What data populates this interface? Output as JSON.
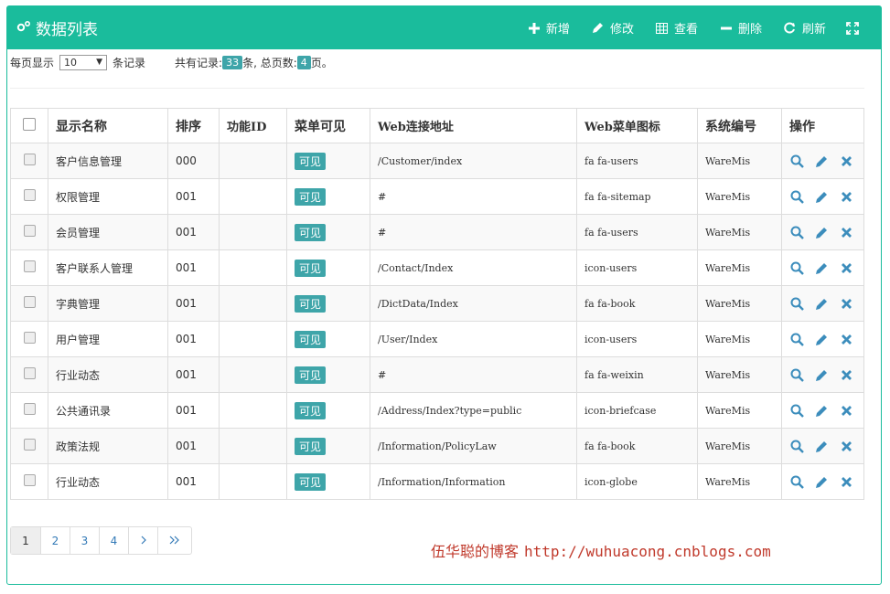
{
  "header": {
    "title": "数据列表",
    "actions": [
      {
        "label": "新增",
        "icon": "plus-icon"
      },
      {
        "label": "修改",
        "icon": "pencil-icon"
      },
      {
        "label": "查看",
        "icon": "table-icon"
      },
      {
        "label": "删除",
        "icon": "minus-icon"
      },
      {
        "label": "刷新",
        "icon": "refresh-icon"
      }
    ],
    "expand_icon": "expand-icon"
  },
  "filter": {
    "per_page_label": "每页显示",
    "per_page_value": "10",
    "records_label": "条记录",
    "total_label": "共有记录:",
    "total_count": "33",
    "total_suffix": "条, 总页数:",
    "pages_count": "4",
    "pages_suffix": "页。"
  },
  "table": {
    "columns": [
      "显示名称",
      "排序",
      "功能ID",
      "菜单可见",
      "Web连接地址",
      "Web菜单图标",
      "系统编号",
      "操作"
    ],
    "rows": [
      {
        "name": "客户信息管理",
        "sort": "000",
        "func_id": "",
        "visible": "可见",
        "url": "/Customer/index",
        "icon": "fa fa-users",
        "sys": "WareMis"
      },
      {
        "name": "权限管理",
        "sort": "001",
        "func_id": "",
        "visible": "可见",
        "url": "#",
        "icon": "fa fa-sitemap",
        "sys": "WareMis"
      },
      {
        "name": "会员管理",
        "sort": "001",
        "func_id": "",
        "visible": "可见",
        "url": "#",
        "icon": "fa fa-users",
        "sys": "WareMis"
      },
      {
        "name": "客户联系人管理",
        "sort": "001",
        "func_id": "",
        "visible": "可见",
        "url": "/Contact/Index",
        "icon": "icon-users",
        "sys": "WareMis"
      },
      {
        "name": "字典管理",
        "sort": "001",
        "func_id": "",
        "visible": "可见",
        "url": "/DictData/Index",
        "icon": "fa fa-book",
        "sys": "WareMis"
      },
      {
        "name": "用户管理",
        "sort": "001",
        "func_id": "",
        "visible": "可见",
        "url": "/User/Index",
        "icon": "icon-users",
        "sys": "WareMis"
      },
      {
        "name": "行业动态",
        "sort": "001",
        "func_id": "",
        "visible": "可见",
        "url": "#",
        "icon": "fa fa-weixin",
        "sys": "WareMis"
      },
      {
        "name": "公共通讯录",
        "sort": "001",
        "func_id": "",
        "visible": "可见",
        "url": "/Address/Index?type=public",
        "icon": "icon-briefcase",
        "sys": "WareMis"
      },
      {
        "name": "政策法规",
        "sort": "001",
        "func_id": "",
        "visible": "可见",
        "url": "/Information/PolicyLaw",
        "icon": "fa fa-book",
        "sys": "WareMis"
      },
      {
        "name": "行业动态",
        "sort": "001",
        "func_id": "",
        "visible": "可见",
        "url": "/Information/Information",
        "icon": "icon-globe",
        "sys": "WareMis"
      }
    ],
    "row_actions": [
      "search-icon",
      "pencil-icon",
      "close-icon"
    ]
  },
  "pagination": {
    "pages": [
      "1",
      "2",
      "3",
      "4"
    ],
    "active": "1",
    "next": "›",
    "last": "»"
  },
  "watermark": {
    "author": "伍华聪的博客",
    "url": "http://wuhuacong.cnblogs.com"
  },
  "colors": {
    "accent": "#1abc9c",
    "badge": "#3ea5a9",
    "link": "#337ab7",
    "op_icon": "#3c8dbc",
    "watermark": "#c0392b"
  }
}
